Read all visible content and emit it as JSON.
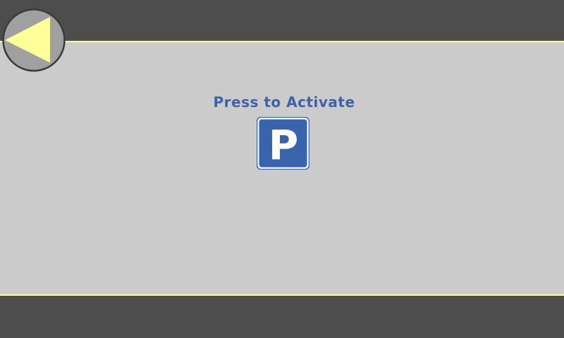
{
  "screen": {
    "prompt_text": "Press to Activate"
  },
  "parking_button": {
    "letter": "P"
  },
  "colors": {
    "header_footer": "#4d4d4d",
    "content_background": "#cbcbcb",
    "accent_line": "#ffff99",
    "prompt_text": "#3b62ad",
    "parking_sign_blue": "#3a63ad",
    "back_button_fill": "#a0a0a0",
    "back_arrow": "#ffff99"
  },
  "icons": {
    "back": "back-arrow-icon",
    "parking": "parking-sign-icon"
  }
}
